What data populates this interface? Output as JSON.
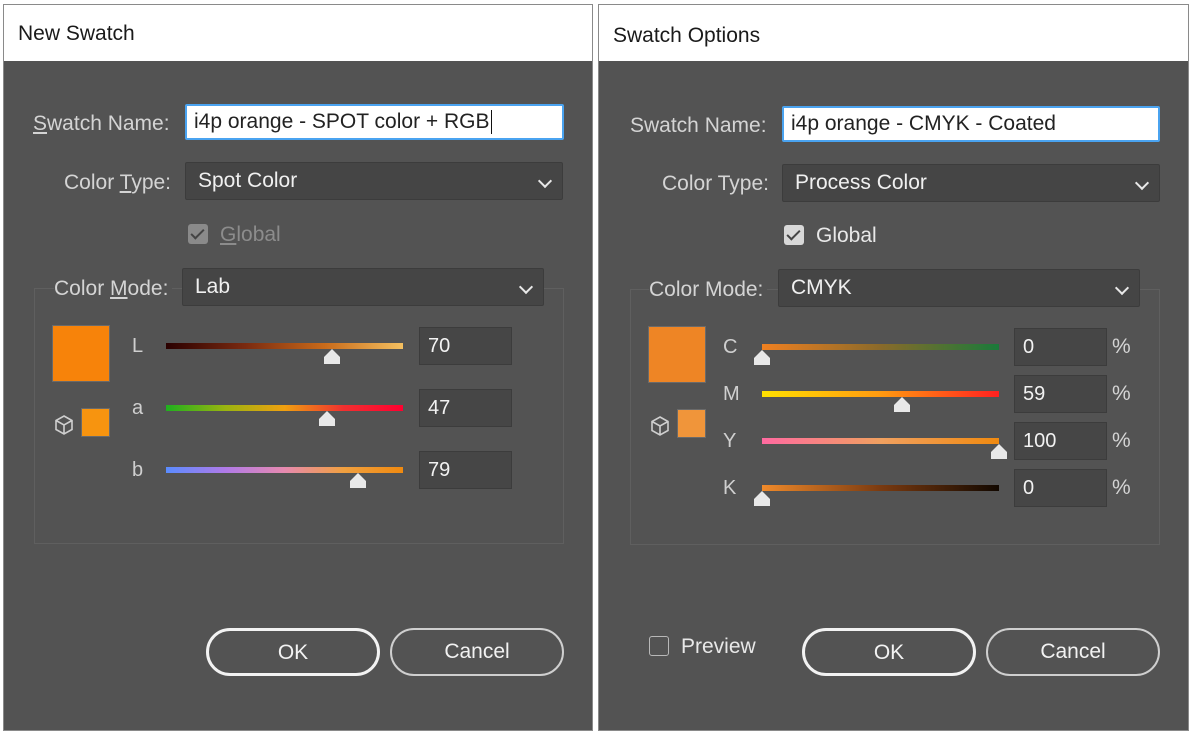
{
  "left": {
    "title": "New Swatch",
    "swatch_name_label_u": "S",
    "swatch_name_label_rest": "watch Name:",
    "swatch_name_value": "i4p orange - SPOT color + RGB",
    "color_type_label_a": "Color ",
    "color_type_label_u": "T",
    "color_type_label_b": "ype:",
    "color_type_value": "Spot Color",
    "global_label_u": "G",
    "global_label_rest": "lobal",
    "global_checked": true,
    "global_disabled": true,
    "color_mode_label_a": "Color ",
    "color_mode_label_u": "M",
    "color_mode_label_b": "ode:",
    "color_mode_value": "Lab",
    "swatch_color": "#f7830a",
    "gamut_color": "#f7940f",
    "channels": [
      {
        "label": "L",
        "value": "70",
        "level": 0.7
      },
      {
        "label": "a",
        "value": "47",
        "level": 0.68
      },
      {
        "label": "b",
        "value": "79",
        "level": 0.81
      }
    ],
    "ok_label": "OK",
    "cancel_label": "Cancel"
  },
  "right": {
    "title": "Swatch Options",
    "swatch_name_label": "Swatch Name:",
    "swatch_name_value": "i4p orange - CMYK - Coated",
    "color_type_label": "Color Type:",
    "color_type_value": "Process Color",
    "global_label": "Global",
    "global_checked": true,
    "color_mode_label": "Color Mode:",
    "color_mode_value": "CMYK",
    "swatch_color": "#ee8525",
    "gamut_color": "#f0953a",
    "channels": [
      {
        "label": "C",
        "value": "0",
        "unit": "%",
        "level": 0.0
      },
      {
        "label": "M",
        "value": "59",
        "unit": "%",
        "level": 0.59
      },
      {
        "label": "Y",
        "value": "100",
        "unit": "%",
        "level": 1.0
      },
      {
        "label": "K",
        "value": "0",
        "unit": "%",
        "level": 0.0
      }
    ],
    "preview_label": "Preview",
    "preview_checked": false,
    "ok_label": "OK",
    "cancel_label": "Cancel"
  }
}
